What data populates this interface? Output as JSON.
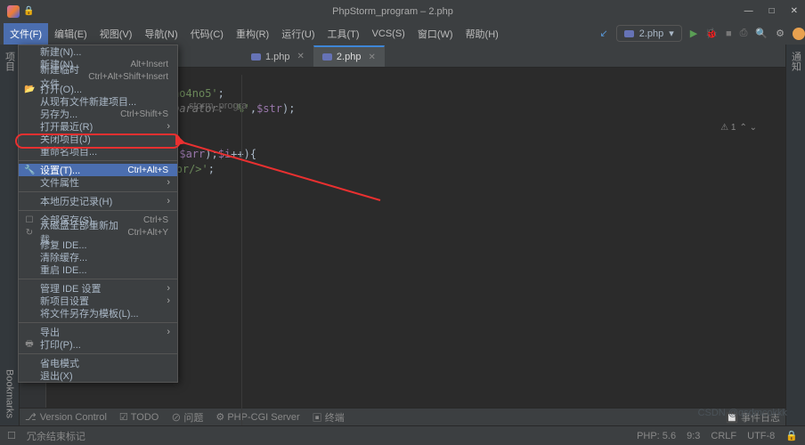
{
  "title": "PhpStorm_program – 2.php",
  "menubar": [
    "文件(F)",
    "编辑(E)",
    "视图(V)",
    "导航(N)",
    "代码(C)",
    "重构(R)",
    "运行(U)",
    "工具(T)",
    "VCS(S)",
    "窗口(W)",
    "帮助(H)"
  ],
  "run_config": "2.php",
  "tabs": [
    {
      "label": "1.php",
      "selected": false
    },
    {
      "label": "2.php",
      "selected": true
    }
  ],
  "project_label": "storm_progra",
  "gutter_left": "项目",
  "gutter_left2": "Bookmarks",
  "gutter_right": "通知",
  "err_warn": "⚠ 1",
  "err_up": "⌃ ⌄",
  "bottom": {
    "vc": "Version Control",
    "todo": "TODO",
    "problems": "问题",
    "server": "PHP-CGI Server",
    "term": "终端"
  },
  "status": {
    "eol": "冗余结束标记",
    "php": "PHP: 5.6",
    "rc": "9:3",
    "enc": "CRLF",
    "cs": "UTF-8",
    "evlog": "事件日志"
  },
  "watermark": "CSDN @qsdmcokkk",
  "menu": [
    {
      "label": "新建(N)...",
      "icon": ""
    },
    {
      "label": "新建(N)",
      "sc": "Alt+Insert"
    },
    {
      "label": "新建临时文件",
      "sc": "Ctrl+Alt+Shift+Insert"
    },
    {
      "label": "打开(O)...",
      "icon": "📂"
    },
    {
      "label": "从现有文件新建项目..."
    },
    {
      "label": "另存为...",
      "sc": "Ctrl+Shift+S"
    },
    {
      "label": "打开最近(R)",
      "sub": true
    },
    {
      "label": "关闭项目(J)"
    },
    {
      "label": "重命名项目..."
    },
    {
      "sep": true
    },
    {
      "label": "设置(T)...",
      "sc": "Ctrl+Alt+S",
      "icon": "🔧",
      "hov": true
    },
    {
      "label": "文件属性",
      "sub": true
    },
    {
      "sep": true
    },
    {
      "label": "本地历史记录(H)",
      "sub": true
    },
    {
      "sep": true
    },
    {
      "label": "全部保存(S)",
      "sc": "Ctrl+S",
      "icon": "☐"
    },
    {
      "label": "从磁盘全部重新加载",
      "sc": "Ctrl+Alt+Y",
      "icon": "↻"
    },
    {
      "label": "修复 IDE..."
    },
    {
      "label": "清除缓存..."
    },
    {
      "label": "重启 IDE..."
    },
    {
      "sep": true
    },
    {
      "label": "管理 IDE 设置",
      "sub": true
    },
    {
      "label": "新项目设置",
      "sub": true
    },
    {
      "label": "将文件另存为模板(L)..."
    },
    {
      "sep": true
    },
    {
      "label": "导出",
      "sub": true
    },
    {
      "label": "打印(P)...",
      "icon": "🖶"
    },
    {
      "sep": true
    },
    {
      "label": "省电模式"
    },
    {
      "label": "退出(X)"
    }
  ]
}
